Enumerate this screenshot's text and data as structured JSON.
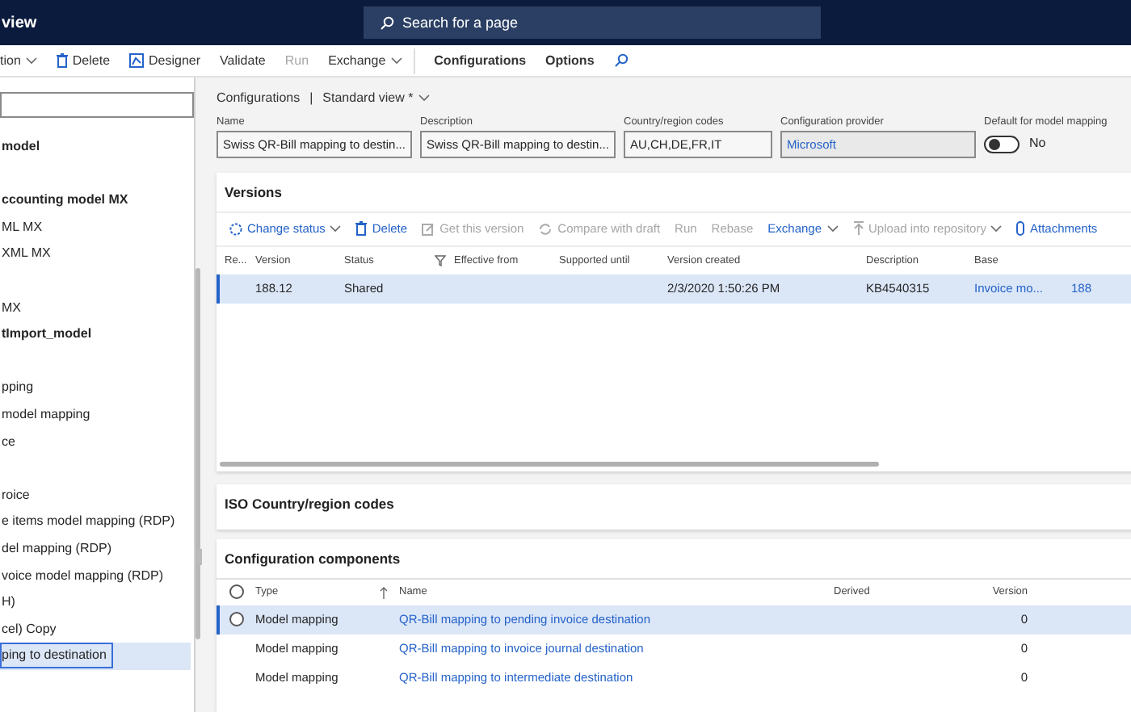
{
  "header": {
    "title": "view",
    "search": {
      "placeholder": "Search for a page"
    }
  },
  "toolbar": [
    {
      "kind": "menu",
      "label": "tion",
      "disabled": false
    },
    {
      "kind": "delete",
      "label": "Delete",
      "disabled": false
    },
    {
      "kind": "designer",
      "label": "Designer",
      "disabled": false
    },
    {
      "kind": "plain",
      "label": "Validate",
      "disabled": false
    },
    {
      "kind": "plain",
      "label": "Run",
      "disabled": true
    },
    {
      "kind": "menu",
      "label": "Exchange",
      "disabled": false
    },
    {
      "kind": "tab",
      "label": "Configurations",
      "disabled": false
    },
    {
      "kind": "tab",
      "label": "Options",
      "disabled": false
    },
    {
      "kind": "search"
    }
  ],
  "tree": {
    "groups": [
      [
        {
          "label": "model",
          "bold": true,
          "selected": false
        }
      ],
      [
        {
          "label": "ccounting model MX",
          "bold": true,
          "selected": false
        },
        {
          "label": "ML MX",
          "bold": false,
          "selected": false
        },
        {
          "label": "XML MX",
          "bold": false,
          "selected": false
        }
      ],
      [
        {
          "label": "MX",
          "bold": false,
          "selected": false
        },
        {
          "label": "tImport_model",
          "bold": true,
          "selected": false
        }
      ],
      [
        {
          "label": "pping",
          "bold": false,
          "selected": false
        },
        {
          "label": "model mapping",
          "bold": false,
          "selected": false
        },
        {
          "label": "ce",
          "bold": false,
          "selected": false
        }
      ],
      [
        {
          "label": "roice",
          "bold": false,
          "selected": false
        },
        {
          "label": "e items model mapping (RDP)",
          "bold": false,
          "selected": false
        },
        {
          "label": "del mapping (RDP)",
          "bold": false,
          "selected": false
        },
        {
          "label": "voice model mapping (RDP)",
          "bold": false,
          "selected": false
        },
        {
          "label": "H)",
          "bold": false,
          "selected": false
        },
        {
          "label": "cel) Copy",
          "bold": false,
          "selected": false
        },
        {
          "label": "ping to destination",
          "bold": false,
          "selected": true
        }
      ]
    ]
  },
  "breadcrumb": {
    "root": "Configurations",
    "separator": "|",
    "view": "Standard view *"
  },
  "fields": [
    {
      "label": "Name",
      "value": "Swiss QR-Bill mapping to destin...",
      "kind": "text"
    },
    {
      "label": "Description",
      "value": "Swiss QR-Bill mapping to destin...",
      "kind": "text"
    },
    {
      "label": "Country/region codes",
      "value": "AU,CH,DE,FR,IT",
      "kind": "text"
    },
    {
      "label": "Configuration provider",
      "value": "Microsoft",
      "kind": "link"
    },
    {
      "label": "Default for model mapping",
      "value": "No",
      "kind": "toggle",
      "on": false
    }
  ],
  "versions": {
    "title": "Versions",
    "actions": [
      {
        "kind": "status",
        "label": "Change status",
        "disabled": false,
        "menu": true
      },
      {
        "kind": "delete",
        "label": "Delete",
        "disabled": false,
        "menu": false
      },
      {
        "kind": "get",
        "label": "Get this version",
        "disabled": true,
        "menu": false
      },
      {
        "kind": "compare",
        "label": "Compare with draft",
        "disabled": true,
        "menu": false
      },
      {
        "kind": "plain",
        "label": "Run",
        "disabled": true,
        "menu": false
      },
      {
        "kind": "plain",
        "label": "Rebase",
        "disabled": true,
        "menu": false
      },
      {
        "kind": "plain",
        "label": "Exchange",
        "disabled": false,
        "menu": true
      },
      {
        "kind": "upload",
        "label": "Upload into repository",
        "disabled": true,
        "menu": true
      },
      {
        "kind": "attach",
        "label": "Attachments",
        "disabled": false,
        "menu": false
      }
    ],
    "columns": [
      "Re...",
      "Version",
      "Status",
      "Effective from",
      "Supported until",
      "Version created",
      "Description",
      "Base"
    ],
    "rows": [
      {
        "selected": true,
        "cells": [
          "",
          "188.12",
          "Shared",
          "",
          "",
          "2/3/2020 1:50:26 PM",
          "KB4540315"
        ],
        "base": "Invoice mo...",
        "base_version": "188"
      }
    ]
  },
  "iso": {
    "title": "ISO Country/region codes"
  },
  "components": {
    "title": "Configuration components",
    "all_checked": false,
    "columns": [
      "Type",
      "Name",
      "Derived",
      "Version"
    ],
    "rows": [
      {
        "selected": true,
        "type": "Model mapping",
        "name": "QR-Bill mapping to pending invoice destination",
        "derived": "",
        "version": "0"
      },
      {
        "selected": false,
        "type": "Model mapping",
        "name": "QR-Bill mapping to invoice journal destination",
        "derived": "",
        "version": "0"
      },
      {
        "selected": false,
        "type": "Model mapping",
        "name": "QR-Bill mapping to intermediate destination",
        "derived": "",
        "version": "0"
      }
    ]
  }
}
